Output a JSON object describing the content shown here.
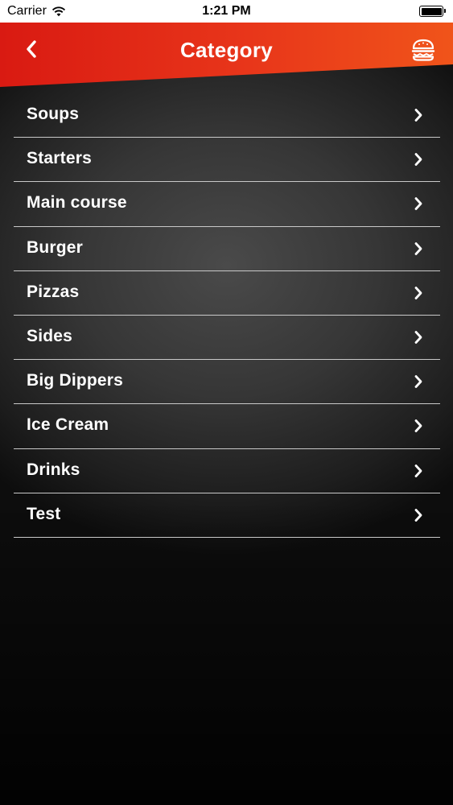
{
  "status_bar": {
    "carrier": "Carrier",
    "time": "1:21 PM",
    "icons": [
      "wifi-icon",
      "battery-icon"
    ]
  },
  "header": {
    "title": "Category",
    "back_icon": "chevron-left-icon",
    "action_icon": "burger-icon",
    "colors": {
      "gradient_start": "#d91a12",
      "gradient_end": "#f0541a"
    }
  },
  "categories": [
    {
      "label": "Soups"
    },
    {
      "label": "Starters"
    },
    {
      "label": "Main course"
    },
    {
      "label": "Burger"
    },
    {
      "label": "Pizzas"
    },
    {
      "label": "Sides"
    },
    {
      "label": "Big Dippers"
    },
    {
      "label": "Ice Cream"
    },
    {
      "label": "Drinks"
    },
    {
      "label": "Test"
    }
  ],
  "item_icon": "chevron-right-icon"
}
